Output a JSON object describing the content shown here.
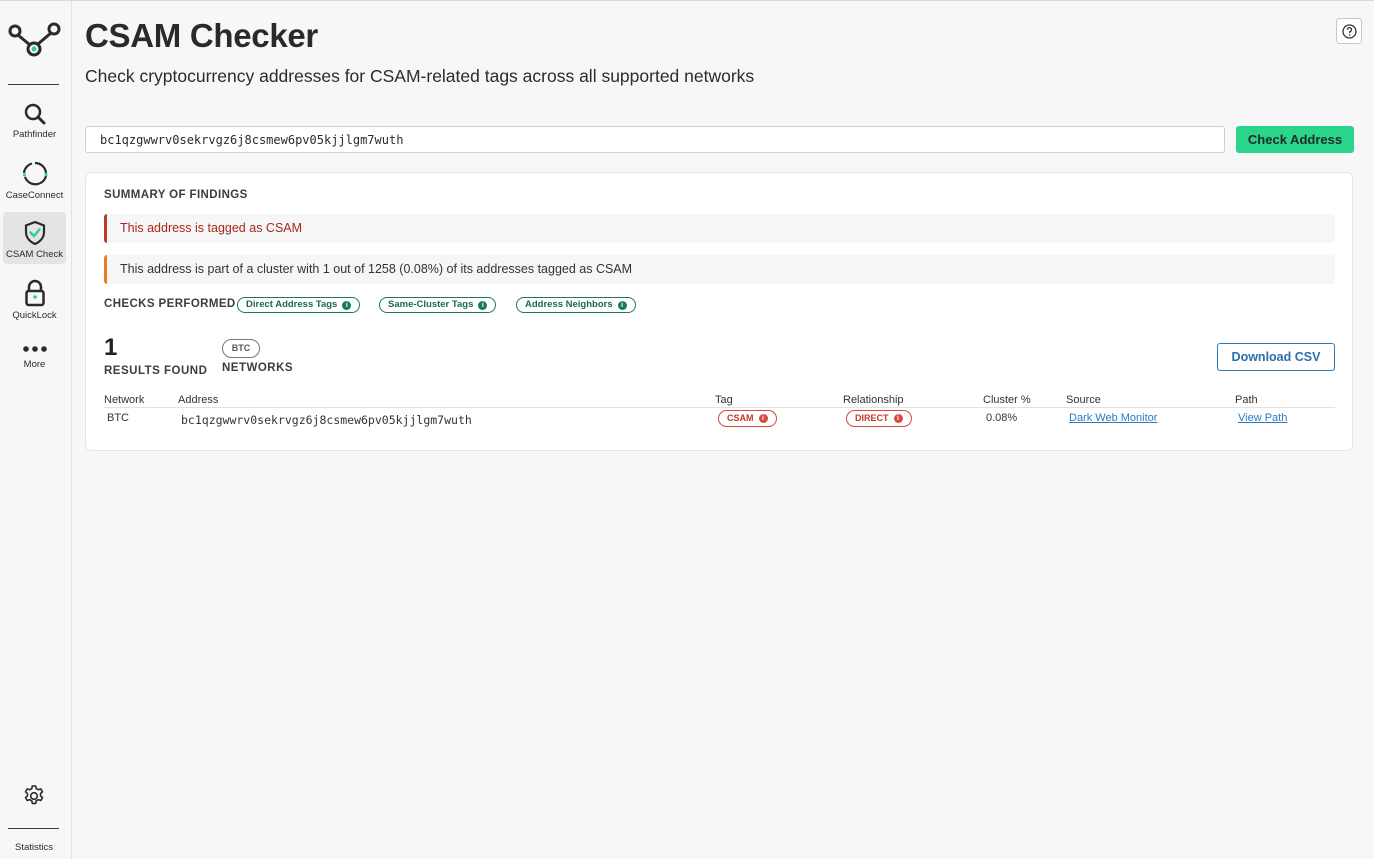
{
  "sidebar": {
    "items": [
      {
        "label": "Pathfinder",
        "icon": "search-icon"
      },
      {
        "label": "CaseConnect",
        "icon": "case-connect-icon"
      },
      {
        "label": "CSAM Check",
        "icon": "shield-check-icon",
        "active": true
      },
      {
        "label": "QuickLock",
        "icon": "lock-icon"
      },
      {
        "label": "More",
        "icon": "more-dots-icon"
      }
    ],
    "settings_icon": "gear-icon",
    "statistics_label": "Statistics"
  },
  "header": {
    "title": "CSAM Checker",
    "subtitle": "Check cryptocurrency addresses for CSAM-related tags across all supported networks",
    "help_icon": "help-icon"
  },
  "search": {
    "value": "bc1qzgwwrv0sekrvgz6j8csmew6pv05kjjlgm7wuth",
    "button_label": "Check Address"
  },
  "summary": {
    "heading": "SUMMARY OF FINDINGS",
    "findings": [
      {
        "text": "This address is tagged as CSAM",
        "severity": "red"
      },
      {
        "text": "This address is part of a cluster with 1 out of 1258 (0.08%) of its addresses tagged as CSAM",
        "severity": "orange"
      }
    ],
    "checks_label": "CHECKS PERFORMED",
    "checks": [
      "Direct Address Tags",
      "Same-Cluster Tags",
      "Address Neighbors"
    ]
  },
  "results": {
    "count": "1",
    "count_label": "RESULTS FOUND",
    "network_badge": "BTC",
    "networks_label": "NETWORKS",
    "download_label": "Download CSV",
    "columns": [
      "Network",
      "Address",
      "Tag",
      "Relationship",
      "Cluster %",
      "Source",
      "Path"
    ],
    "rows": [
      {
        "network": "BTC",
        "address": "bc1qzgwwrv0sekrvgz6j8csmew6pv05kjjlgm7wuth",
        "tag": "CSAM",
        "relationship": "DIRECT",
        "cluster_pct": "0.08%",
        "source": "Dark Web Monitor",
        "path": "View Path"
      }
    ]
  },
  "colors": {
    "accent_green": "#2bd48b",
    "chip_green": "#1a7a55",
    "alert_red": "#d64a3b",
    "alert_orange": "#e67e22",
    "link_blue": "#2a7bbd"
  }
}
